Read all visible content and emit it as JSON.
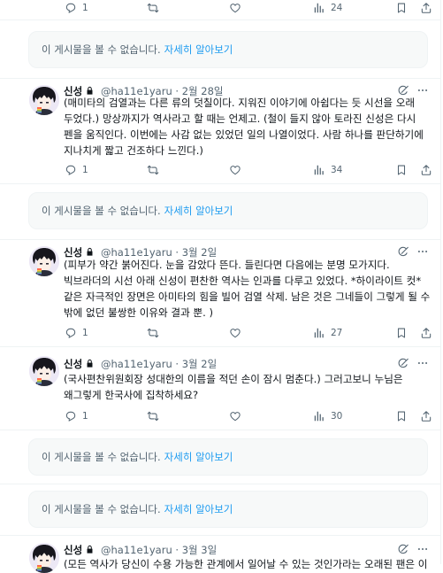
{
  "topbar": {
    "reply_count": "1",
    "view_count": "24"
  },
  "notices": [
    {
      "text": "이 게시물을 볼 수 없습니다.",
      "link": "자세히 알아보기"
    },
    {
      "text": "이 게시물을 볼 수 없습니다.",
      "link": "자세히 알아보기"
    },
    {
      "text": "이 게시물을 볼 수 없습니다.",
      "link": "자세히 알아보기"
    },
    {
      "text": "이 게시물을 볼 수 없습니다.",
      "link": "자세히 알아보기"
    }
  ],
  "posts": [
    {
      "name": "신성",
      "handle": "@ha11e1yaru",
      "date": "2월 28일",
      "text": "(매미타의 검열과는 다른 류의 덧칠이다. 지워진 이야기에 아쉽다는 듯 시선을 오래 두었다.) 망상까지가 역사라고 할 때는 언제고. (철이 들지 않아 토라진 신성은 다시 펜을 움직인다. 이번에는 사감 없는 있었던 일의 나열이었다. 사람 하나를 판단하기에 지나치게 짧고 건조하다 느낀다.)",
      "replies": "1",
      "views": "34"
    },
    {
      "name": "신성",
      "handle": "@ha11e1yaru",
      "date": "3월 2일",
      "text": "(피부가 약간 붉어진다. 눈을 감았다 뜬다. 들린다면 다음에는 분명 모가지다. 빅브라더의 시선 아래 신성이 편찬한 역사는 인과를 다루고 있었다. *하이라이트 컷* 같은 자극적인 장면은 아미타의 힘을 빌어 검열 삭제. 남은 것은 그네들이 그렇게 될 수 밖에 없던 불쌍한 이유와 결과 뿐. )",
      "replies": "1",
      "views": "27"
    },
    {
      "name": "신성",
      "handle": "@ha11e1yaru",
      "date": "3월 2일",
      "text": "(국사편찬위원회장 성대한의 이름을 적던 손이 잠시 멈춘다.) 그러고보니 누님은 왜그렇게 한국사에 집착하세요?",
      "replies": "1",
      "views": "30"
    },
    {
      "name": "신성",
      "handle": "@ha11e1yaru",
      "date": "3월 3일",
      "text": "(모든 역사가 당신이 수용 가능한 관계에서 일어날 수 있는 것인가라는 오래된 팬은 이"
    }
  ],
  "colors": {
    "accent": "#1d9bf0",
    "muted": "#536471",
    "text": "#0f1419",
    "divider": "#eff3f4",
    "notice_bg": "#f7f9f9"
  }
}
